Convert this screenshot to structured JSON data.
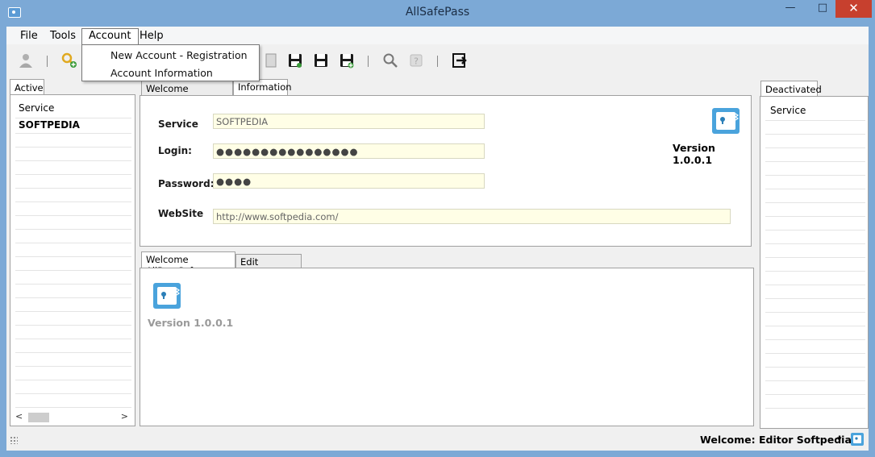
{
  "window": {
    "title": "AllSafePass",
    "controls": {
      "minimize": "—",
      "maximize": "□",
      "close": "✕"
    }
  },
  "menu": {
    "items": [
      "File",
      "Tools",
      "Account",
      "Help"
    ],
    "open_menu": "Account",
    "dropdown": [
      "New Account - Registration",
      "Account Information"
    ]
  },
  "toolbar": {
    "icons": [
      "user-icon",
      "key-add-icon",
      "document-icon",
      "save-icon",
      "save-icon",
      "save-add-icon",
      "search-icon",
      "help-icon",
      "exit-icon"
    ]
  },
  "left_panel": {
    "tab": "Active",
    "header": "Service",
    "rows": [
      "SOFTPEDIA"
    ],
    "scroll_left": "<",
    "scroll_right": ">"
  },
  "right_panel": {
    "tab": "Deactivated",
    "header": "Service"
  },
  "top_tabs": [
    "Welcome AllPassSafe",
    "Information"
  ],
  "info": {
    "service_label": "Service",
    "service_value": "SOFTPEDIA",
    "login_label": "Login:",
    "login_value": "●●●●●●●●●●●●●●●●",
    "password_label": "Password:",
    "password_value": "●●●●",
    "website_label": "WebSite",
    "website_value": "http://www.softpedia.com/",
    "version": "Version 1.0.0.1"
  },
  "bottom_tabs": [
    "Welcome AllPassSafe",
    "Edit Information"
  ],
  "welcome": {
    "version": "Version 1.0.0.1"
  },
  "status": {
    "text": "Welcome: Editor Softpedia",
    "caret": "▾"
  },
  "colors": {
    "titlebar": "#7ca9d6",
    "field_bg": "#fffee6",
    "accent_blue": "#4a9fd8",
    "close_red": "#c7402e"
  }
}
